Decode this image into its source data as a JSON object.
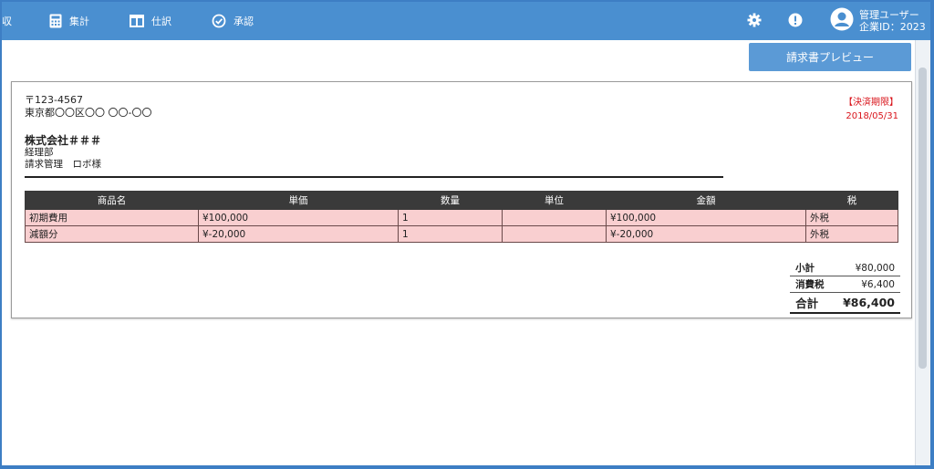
{
  "nav": {
    "cut_label": "収",
    "items": [
      {
        "label": "集計",
        "icon": "calculator-icon"
      },
      {
        "label": "仕訳",
        "icon": "columns-icon"
      },
      {
        "label": "承認",
        "icon": "check-circle-icon"
      }
    ]
  },
  "header_icons": [
    "gear-icon",
    "alert-icon",
    "user-avatar-icon"
  ],
  "user": {
    "name": "管理ユーザー",
    "company_id": "企業ID：2023"
  },
  "actions": {
    "preview_button": "請求書プレビュー"
  },
  "invoice": {
    "postal": "〒123-4567",
    "address": "東京都〇〇区〇〇 〇〇-〇〇",
    "company": "株式会社＃＃＃",
    "department": "経理部",
    "contact": "請求管理　ロボ様",
    "due_label": "【決済期限】",
    "due_date": "2018/05/31",
    "columns": [
      "商品名",
      "単価",
      "数量",
      "単位",
      "金額",
      "税"
    ],
    "rows": [
      [
        "初期費用",
        "¥100,000",
        "1",
        "",
        "¥100,000",
        "外税"
      ],
      [
        "減額分",
        "¥-20,000",
        "1",
        "",
        "¥-20,000",
        "外税"
      ]
    ],
    "totals": {
      "subtotal_label": "小計",
      "subtotal": "¥80,000",
      "tax_label": "消費税",
      "tax": "¥6,400",
      "total_label": "合計",
      "total": "¥86,400"
    }
  },
  "colors": {
    "header": "#4a8fd0",
    "table_head": "#3a3a3a",
    "row_bg": "#f9cfd0",
    "due": "#d9141b",
    "button": "#5b9ad6"
  }
}
